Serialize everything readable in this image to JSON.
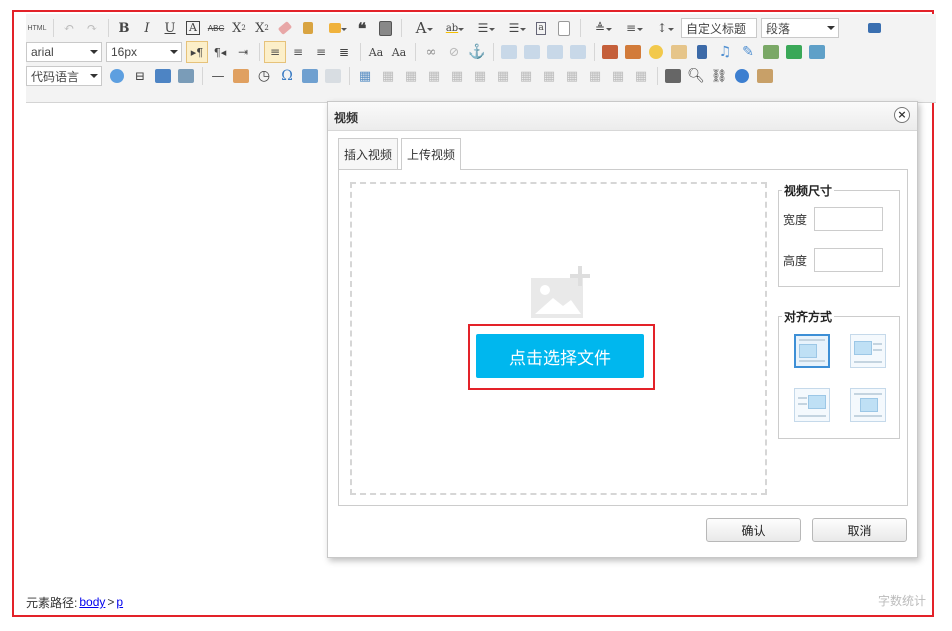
{
  "toolbar": {
    "html_label": "HTML",
    "font_family": "arial",
    "font_size": "16px",
    "custom_title": "自定义标题",
    "paragraph": "段落",
    "code_language": "代码语言"
  },
  "statusbar": {
    "path_label": "元素路径:",
    "path_body": "body",
    "path_sep": ">",
    "path_p": "p",
    "word_count": "字数统计"
  },
  "dialog": {
    "title": "视频",
    "close_symbol": "×",
    "tabs": [
      {
        "label": "插入视频",
        "active": false
      },
      {
        "label": "上传视频",
        "active": true
      }
    ],
    "choose_button": "点击选择文件",
    "size_legend": "视频尺寸",
    "width_label": "宽度",
    "height_label": "高度",
    "width_value": "",
    "height_value": "",
    "align_legend": "对齐方式",
    "ok_button": "确认",
    "cancel_button": "取消"
  },
  "colors": {
    "highlight_border": "#e32229",
    "choose_button_bg": "#00b7ee"
  }
}
